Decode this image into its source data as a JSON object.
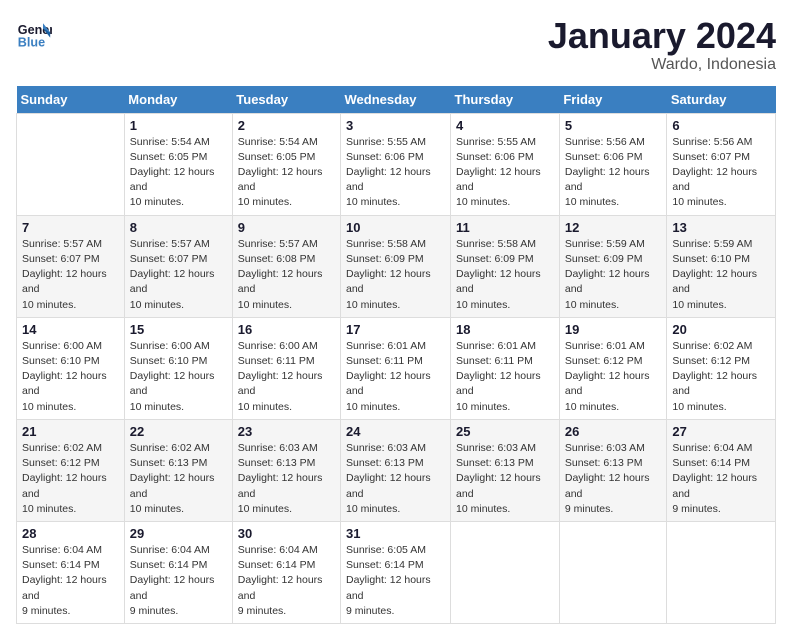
{
  "header": {
    "logo_line1": "General",
    "logo_line2": "Blue",
    "month": "January 2024",
    "location": "Wardo, Indonesia"
  },
  "weekdays": [
    "Sunday",
    "Monday",
    "Tuesday",
    "Wednesday",
    "Thursday",
    "Friday",
    "Saturday"
  ],
  "weeks": [
    [
      {
        "day": "",
        "sunrise": "",
        "sunset": "",
        "daylight": ""
      },
      {
        "day": "1",
        "sunrise": "Sunrise: 5:54 AM",
        "sunset": "Sunset: 6:05 PM",
        "daylight": "Daylight: 12 hours and 10 minutes."
      },
      {
        "day": "2",
        "sunrise": "Sunrise: 5:54 AM",
        "sunset": "Sunset: 6:05 PM",
        "daylight": "Daylight: 12 hours and 10 minutes."
      },
      {
        "day": "3",
        "sunrise": "Sunrise: 5:55 AM",
        "sunset": "Sunset: 6:06 PM",
        "daylight": "Daylight: 12 hours and 10 minutes."
      },
      {
        "day": "4",
        "sunrise": "Sunrise: 5:55 AM",
        "sunset": "Sunset: 6:06 PM",
        "daylight": "Daylight: 12 hours and 10 minutes."
      },
      {
        "day": "5",
        "sunrise": "Sunrise: 5:56 AM",
        "sunset": "Sunset: 6:06 PM",
        "daylight": "Daylight: 12 hours and 10 minutes."
      },
      {
        "day": "6",
        "sunrise": "Sunrise: 5:56 AM",
        "sunset": "Sunset: 6:07 PM",
        "daylight": "Daylight: 12 hours and 10 minutes."
      }
    ],
    [
      {
        "day": "7",
        "sunrise": "Sunrise: 5:57 AM",
        "sunset": "Sunset: 6:07 PM",
        "daylight": "Daylight: 12 hours and 10 minutes."
      },
      {
        "day": "8",
        "sunrise": "Sunrise: 5:57 AM",
        "sunset": "Sunset: 6:07 PM",
        "daylight": "Daylight: 12 hours and 10 minutes."
      },
      {
        "day": "9",
        "sunrise": "Sunrise: 5:57 AM",
        "sunset": "Sunset: 6:08 PM",
        "daylight": "Daylight: 12 hours and 10 minutes."
      },
      {
        "day": "10",
        "sunrise": "Sunrise: 5:58 AM",
        "sunset": "Sunset: 6:09 PM",
        "daylight": "Daylight: 12 hours and 10 minutes."
      },
      {
        "day": "11",
        "sunrise": "Sunrise: 5:58 AM",
        "sunset": "Sunset: 6:09 PM",
        "daylight": "Daylight: 12 hours and 10 minutes."
      },
      {
        "day": "12",
        "sunrise": "Sunrise: 5:59 AM",
        "sunset": "Sunset: 6:09 PM",
        "daylight": "Daylight: 12 hours and 10 minutes."
      },
      {
        "day": "13",
        "sunrise": "Sunrise: 5:59 AM",
        "sunset": "Sunset: 6:10 PM",
        "daylight": "Daylight: 12 hours and 10 minutes."
      }
    ],
    [
      {
        "day": "14",
        "sunrise": "Sunrise: 6:00 AM",
        "sunset": "Sunset: 6:10 PM",
        "daylight": "Daylight: 12 hours and 10 minutes."
      },
      {
        "day": "15",
        "sunrise": "Sunrise: 6:00 AM",
        "sunset": "Sunset: 6:10 PM",
        "daylight": "Daylight: 12 hours and 10 minutes."
      },
      {
        "day": "16",
        "sunrise": "Sunrise: 6:00 AM",
        "sunset": "Sunset: 6:11 PM",
        "daylight": "Daylight: 12 hours and 10 minutes."
      },
      {
        "day": "17",
        "sunrise": "Sunrise: 6:01 AM",
        "sunset": "Sunset: 6:11 PM",
        "daylight": "Daylight: 12 hours and 10 minutes."
      },
      {
        "day": "18",
        "sunrise": "Sunrise: 6:01 AM",
        "sunset": "Sunset: 6:11 PM",
        "daylight": "Daylight: 12 hours and 10 minutes."
      },
      {
        "day": "19",
        "sunrise": "Sunrise: 6:01 AM",
        "sunset": "Sunset: 6:12 PM",
        "daylight": "Daylight: 12 hours and 10 minutes."
      },
      {
        "day": "20",
        "sunrise": "Sunrise: 6:02 AM",
        "sunset": "Sunset: 6:12 PM",
        "daylight": "Daylight: 12 hours and 10 minutes."
      }
    ],
    [
      {
        "day": "21",
        "sunrise": "Sunrise: 6:02 AM",
        "sunset": "Sunset: 6:12 PM",
        "daylight": "Daylight: 12 hours and 10 minutes."
      },
      {
        "day": "22",
        "sunrise": "Sunrise: 6:02 AM",
        "sunset": "Sunset: 6:13 PM",
        "daylight": "Daylight: 12 hours and 10 minutes."
      },
      {
        "day": "23",
        "sunrise": "Sunrise: 6:03 AM",
        "sunset": "Sunset: 6:13 PM",
        "daylight": "Daylight: 12 hours and 10 minutes."
      },
      {
        "day": "24",
        "sunrise": "Sunrise: 6:03 AM",
        "sunset": "Sunset: 6:13 PM",
        "daylight": "Daylight: 12 hours and 10 minutes."
      },
      {
        "day": "25",
        "sunrise": "Sunrise: 6:03 AM",
        "sunset": "Sunset: 6:13 PM",
        "daylight": "Daylight: 12 hours and 10 minutes."
      },
      {
        "day": "26",
        "sunrise": "Sunrise: 6:03 AM",
        "sunset": "Sunset: 6:13 PM",
        "daylight": "Daylight: 12 hours and 9 minutes."
      },
      {
        "day": "27",
        "sunrise": "Sunrise: 6:04 AM",
        "sunset": "Sunset: 6:14 PM",
        "daylight": "Daylight: 12 hours and 9 minutes."
      }
    ],
    [
      {
        "day": "28",
        "sunrise": "Sunrise: 6:04 AM",
        "sunset": "Sunset: 6:14 PM",
        "daylight": "Daylight: 12 hours and 9 minutes."
      },
      {
        "day": "29",
        "sunrise": "Sunrise: 6:04 AM",
        "sunset": "Sunset: 6:14 PM",
        "daylight": "Daylight: 12 hours and 9 minutes."
      },
      {
        "day": "30",
        "sunrise": "Sunrise: 6:04 AM",
        "sunset": "Sunset: 6:14 PM",
        "daylight": "Daylight: 12 hours and 9 minutes."
      },
      {
        "day": "31",
        "sunrise": "Sunrise: 6:05 AM",
        "sunset": "Sunset: 6:14 PM",
        "daylight": "Daylight: 12 hours and 9 minutes."
      },
      {
        "day": "",
        "sunrise": "",
        "sunset": "",
        "daylight": ""
      },
      {
        "day": "",
        "sunrise": "",
        "sunset": "",
        "daylight": ""
      },
      {
        "day": "",
        "sunrise": "",
        "sunset": "",
        "daylight": ""
      }
    ]
  ]
}
